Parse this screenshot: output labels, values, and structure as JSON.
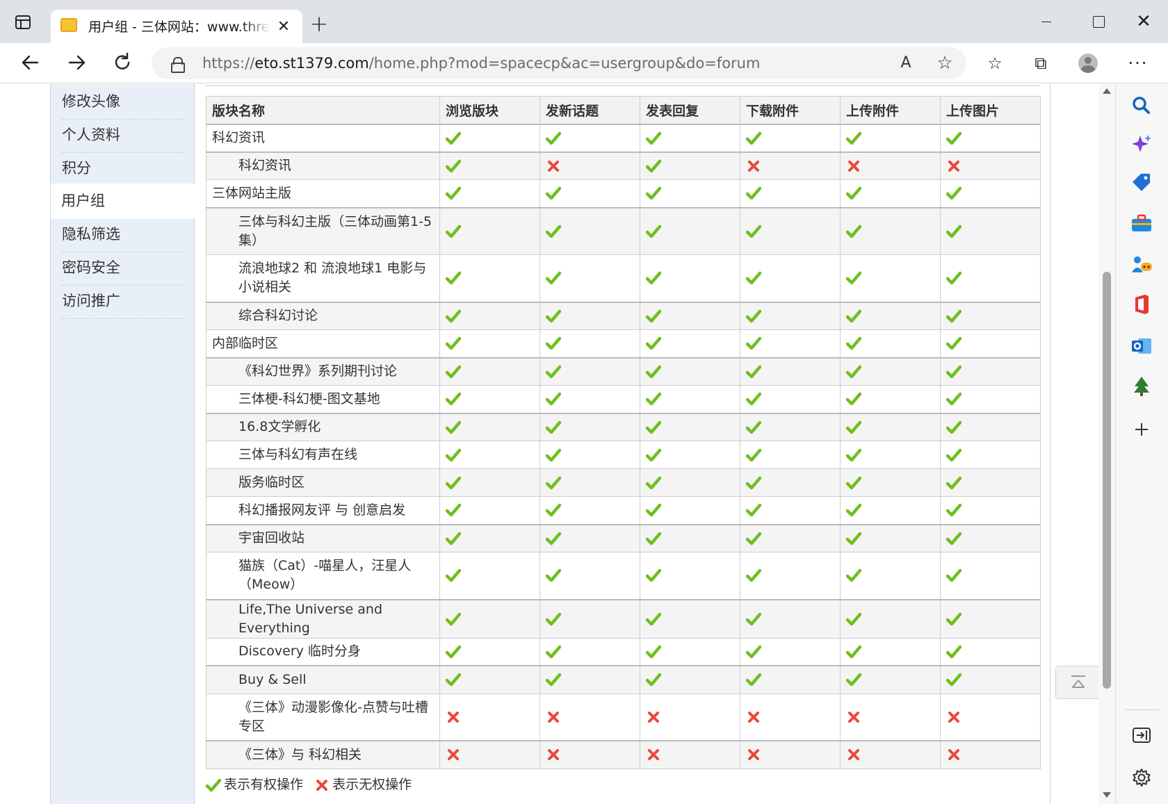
{
  "browser": {
    "tab": {
      "title": "用户组 - 三体网站：www.threebody.com",
      "close_glyph": "✕"
    },
    "new_tab_glyph": "+",
    "address_bar": {
      "url_prefix": "https://",
      "url_host": "eto.st1379.com",
      "url_path": "/home.php?mod=spacecp&ac=usergroup&do=forum"
    },
    "read_aloud_glyph": "A",
    "add_favorite_glyph": "☆",
    "favorites_glyph": "☆",
    "collections_glyph": "⧉",
    "more_glyph": "···"
  },
  "side_menu": {
    "items": [
      {
        "label": "修改头像"
      },
      {
        "label": "个人资料"
      },
      {
        "label": "积分"
      },
      {
        "label": "用户组"
      },
      {
        "label": "隐私筛选"
      },
      {
        "label": "密码安全"
      },
      {
        "label": "访问推广"
      }
    ],
    "active": "用户组"
  },
  "table": {
    "headers": [
      "版块名称",
      "浏览版块",
      "发新话题",
      "发表回复",
      "下载附件",
      "上传附件",
      "上传图片"
    ],
    "rows": [
      {
        "name": "科幻资讯",
        "level": 0,
        "perms": [
          1,
          1,
          1,
          1,
          1,
          1
        ]
      },
      {
        "name": "科幻资讯",
        "level": 1,
        "perms": [
          1,
          0,
          1,
          0,
          0,
          0
        ]
      },
      {
        "name": "三体网站主版",
        "level": 0,
        "perms": [
          1,
          1,
          1,
          1,
          1,
          1
        ]
      },
      {
        "name": "三体与科幻主版（三体动画第1-5集）",
        "level": 1,
        "perms": [
          1,
          1,
          1,
          1,
          1,
          1
        ]
      },
      {
        "name": "流浪地球2 和 流浪地球1 电影与小说相关",
        "level": 1,
        "perms": [
          1,
          1,
          1,
          1,
          1,
          1
        ]
      },
      {
        "name": "综合科幻讨论",
        "level": 1,
        "perms": [
          1,
          1,
          1,
          1,
          1,
          1
        ]
      },
      {
        "name": "内部临时区",
        "level": 0,
        "perms": [
          1,
          1,
          1,
          1,
          1,
          1
        ]
      },
      {
        "name": "《科幻世界》系列期刊讨论",
        "level": 1,
        "perms": [
          1,
          1,
          1,
          1,
          1,
          1
        ]
      },
      {
        "name": "三体梗-科幻梗-图文基地",
        "level": 1,
        "perms": [
          1,
          1,
          1,
          1,
          1,
          1
        ]
      },
      {
        "name": "16.8文学孵化",
        "level": 1,
        "perms": [
          1,
          1,
          1,
          1,
          1,
          1
        ]
      },
      {
        "name": "三体与科幻有声在线",
        "level": 1,
        "perms": [
          1,
          1,
          1,
          1,
          1,
          1
        ]
      },
      {
        "name": "版务临时区",
        "level": 1,
        "perms": [
          1,
          1,
          1,
          1,
          1,
          1
        ]
      },
      {
        "name": "科幻播报网友评 与 创意启发",
        "level": 1,
        "perms": [
          1,
          1,
          1,
          1,
          1,
          1
        ]
      },
      {
        "name": "宇宙回收站",
        "level": 1,
        "perms": [
          1,
          1,
          1,
          1,
          1,
          1
        ]
      },
      {
        "name": "猫族（Cat）-喵星人，汪星人（Meow）",
        "level": 1,
        "perms": [
          1,
          1,
          1,
          1,
          1,
          1
        ]
      },
      {
        "name": "Life,The Universe and Everything",
        "level": 1,
        "perms": [
          1,
          1,
          1,
          1,
          1,
          1
        ]
      },
      {
        "name": "Discovery 临时分身",
        "level": 1,
        "perms": [
          1,
          1,
          1,
          1,
          1,
          1
        ]
      },
      {
        "name": "Buy & Sell",
        "level": 1,
        "perms": [
          1,
          1,
          1,
          1,
          1,
          1
        ]
      },
      {
        "name": "《三体》动漫影像化-点赞与吐槽专区",
        "level": 1,
        "perms": [
          0,
          0,
          0,
          0,
          0,
          0
        ]
      },
      {
        "name": "《三体》与 科幻相关",
        "level": 1,
        "perms": [
          0,
          0,
          0,
          0,
          0,
          0
        ]
      }
    ]
  },
  "legend": {
    "allow": "表示有权操作",
    "deny": "表示无权操作"
  },
  "icons": {
    "allow": "check-icon",
    "deny": "cross-icon"
  },
  "colors": {
    "allow": "#6fbf1f",
    "deny": "#e8493d"
  }
}
